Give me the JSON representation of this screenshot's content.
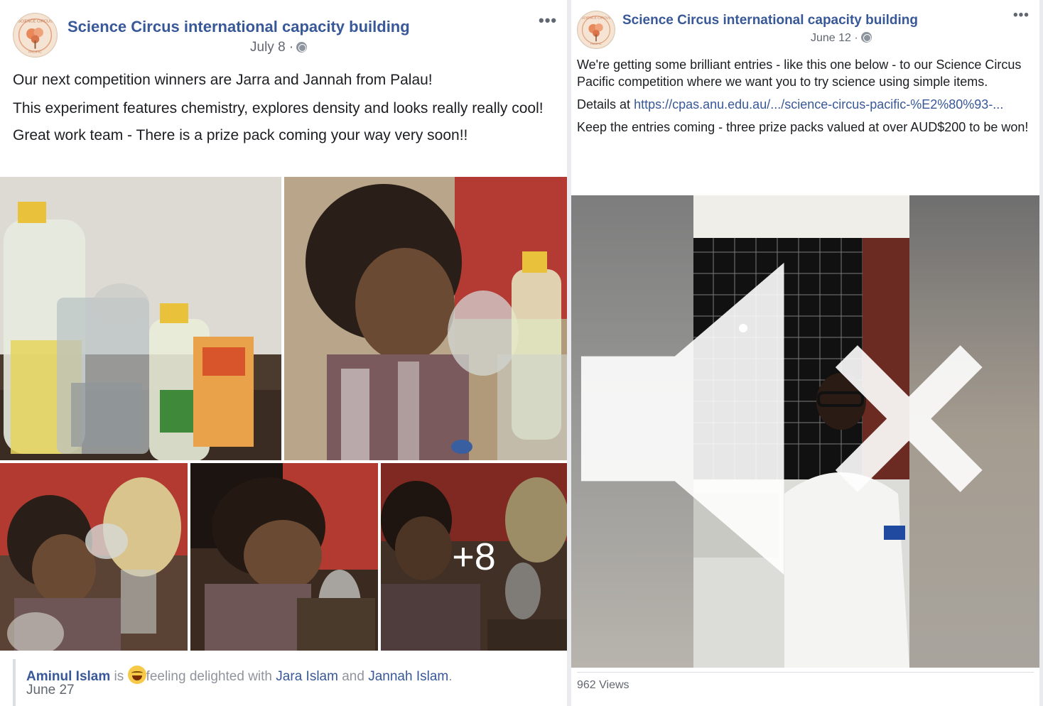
{
  "left_post": {
    "page_name": "Science Circus international capacity building",
    "date": "July 8 ·",
    "more": "•••",
    "text_lines": [
      "Our next competition winners are Jarra and Jannah from Palau!",
      "This experiment features chemistry, explores density and looks really really cool!",
      "Great work team - There is a prize pack coming your way very soon!!"
    ],
    "photo_overlay": "+8",
    "activity": {
      "actor": "Aminul Islam",
      "is": "is",
      "feeling": "feeling delighted with",
      "tag1": "Jara Islam",
      "and": "and",
      "tag2": "Jannah Islam",
      "period": ".",
      "date": "June 27"
    }
  },
  "right_post": {
    "page_name": "Science Circus international capacity building",
    "date": "June 12 ·",
    "more": "•••",
    "text1": "We're getting some brilliant entries - like this one below - to our Science Circus Pacific competition where we want you to try science using simple items.",
    "details_prefix": "Details at",
    "details_link": "https://cpas.anu.edu.au/.../science-circus-pacific-%E2%80%93-...",
    "text3": "Keep the entries coming - three prize packs valued at over AUD$200 to be won!",
    "views": "962 Views"
  },
  "avatar_text": {
    "top": "SCIENCE CIRCUS",
    "bottom": "PACIFIC"
  },
  "colors": {
    "link": "#385898",
    "text": "#1c1e21",
    "secondary": "#616770",
    "background": "#e9ebee"
  },
  "icons": [
    "globe-icon",
    "more-options-icon",
    "feeling-emoji-icon",
    "mute-icon"
  ]
}
